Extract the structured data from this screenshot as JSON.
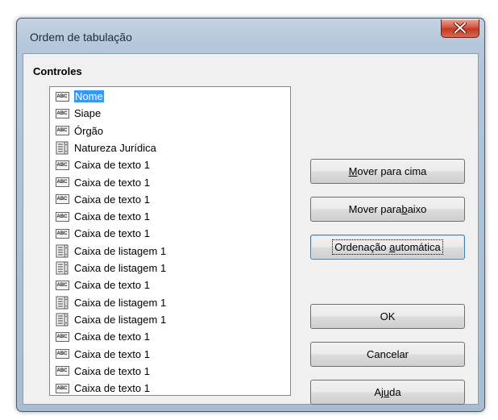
{
  "window": {
    "title": "Ordem de tabulação"
  },
  "controls": {
    "label": "Controles",
    "items": [
      {
        "label": "Nome",
        "icon": "text-field-icon",
        "selected": true
      },
      {
        "label": "Siape",
        "icon": "text-field-icon"
      },
      {
        "label": "Órgão",
        "icon": "text-field-icon"
      },
      {
        "label": "Natureza Jurídica",
        "icon": "list-box-icon"
      },
      {
        "label": "Caixa de texto 1",
        "icon": "text-field-icon"
      },
      {
        "label": "Caixa de texto 1",
        "icon": "text-field-icon"
      },
      {
        "label": "Caixa de texto 1",
        "icon": "text-field-icon"
      },
      {
        "label": "Caixa de texto 1",
        "icon": "text-field-icon"
      },
      {
        "label": "Caixa de texto 1",
        "icon": "text-field-icon"
      },
      {
        "label": "Caixa de listagem 1",
        "icon": "list-box-icon"
      },
      {
        "label": "Caixa de listagem 1",
        "icon": "list-box-icon"
      },
      {
        "label": "Caixa de texto 1",
        "icon": "text-field-icon"
      },
      {
        "label": "Caixa de listagem 1",
        "icon": "list-box-icon"
      },
      {
        "label": "Caixa de listagem 1",
        "icon": "list-box-icon"
      },
      {
        "label": "Caixa de texto 1",
        "icon": "text-field-icon"
      },
      {
        "label": "Caixa de texto 1",
        "icon": "text-field-icon"
      },
      {
        "label": "Caixa de texto 1",
        "icon": "text-field-icon"
      },
      {
        "label": "Caixa de texto 1",
        "icon": "text-field-icon"
      }
    ]
  },
  "icons": {
    "abc_text": "ABC"
  },
  "buttons": {
    "move_up": {
      "before": "",
      "mnemonic": "M",
      "after": "over para cima"
    },
    "move_down": {
      "before": "Mover para ",
      "mnemonic": "b",
      "after": "aixo"
    },
    "auto_sort": {
      "before": "Ordenação ",
      "mnemonic": "a",
      "after": "utomática"
    },
    "ok": "OK",
    "cancel": "Cancelar",
    "help": {
      "before": "Aj",
      "mnemonic": "u",
      "after": "da"
    }
  },
  "colors": {
    "selection": "#3399ff",
    "close_button": "#c23b23"
  }
}
